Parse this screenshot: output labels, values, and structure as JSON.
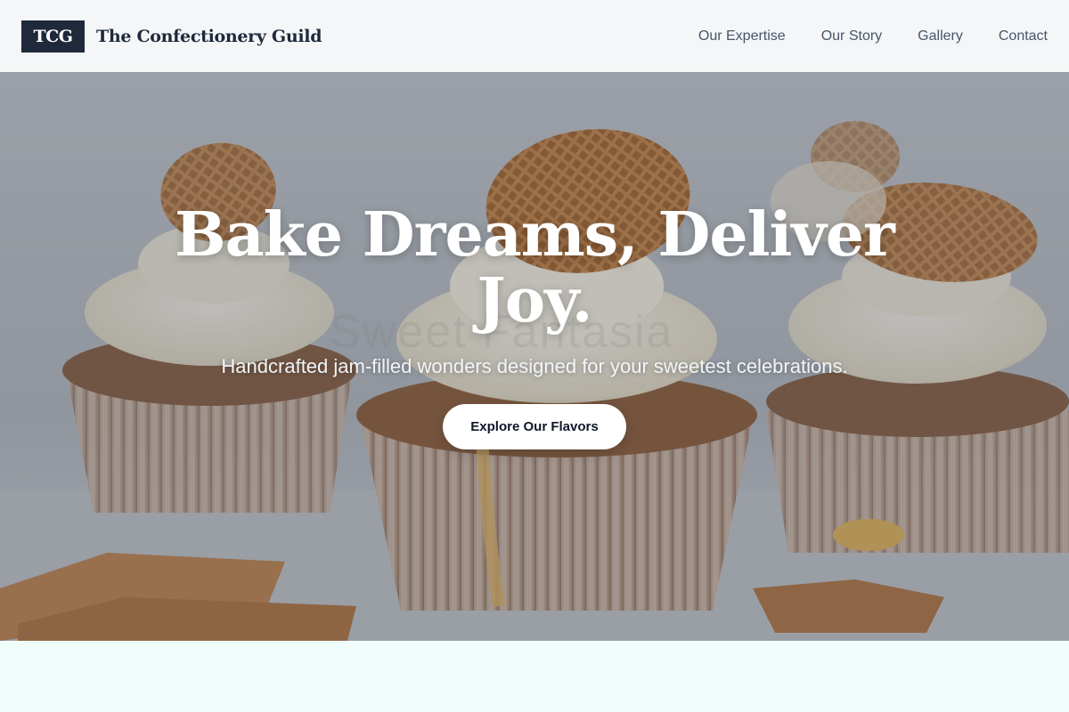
{
  "header": {
    "logo_text": "TCG",
    "brand_name": "The Confectionery Guild",
    "nav": [
      {
        "label": "Our Expertise"
      },
      {
        "label": "Our Story"
      },
      {
        "label": "Gallery"
      },
      {
        "label": "Contact"
      }
    ]
  },
  "hero": {
    "title": "Bake Dreams, Deliver Joy.",
    "subtitle": "Handcrafted jam-filled wonders designed for your sweetest celebrations.",
    "cta_label": "Explore Our Flavors",
    "background_watermark": "Sweet Fantasia",
    "background_image": "cupcakes-with-waffle-cookies"
  },
  "colors": {
    "header_bg": "#f5f6f7",
    "brand_dark": "#1e293b",
    "nav_text": "#475569",
    "page_bg": "#f0fdfa",
    "cta_bg": "#ffffff"
  }
}
